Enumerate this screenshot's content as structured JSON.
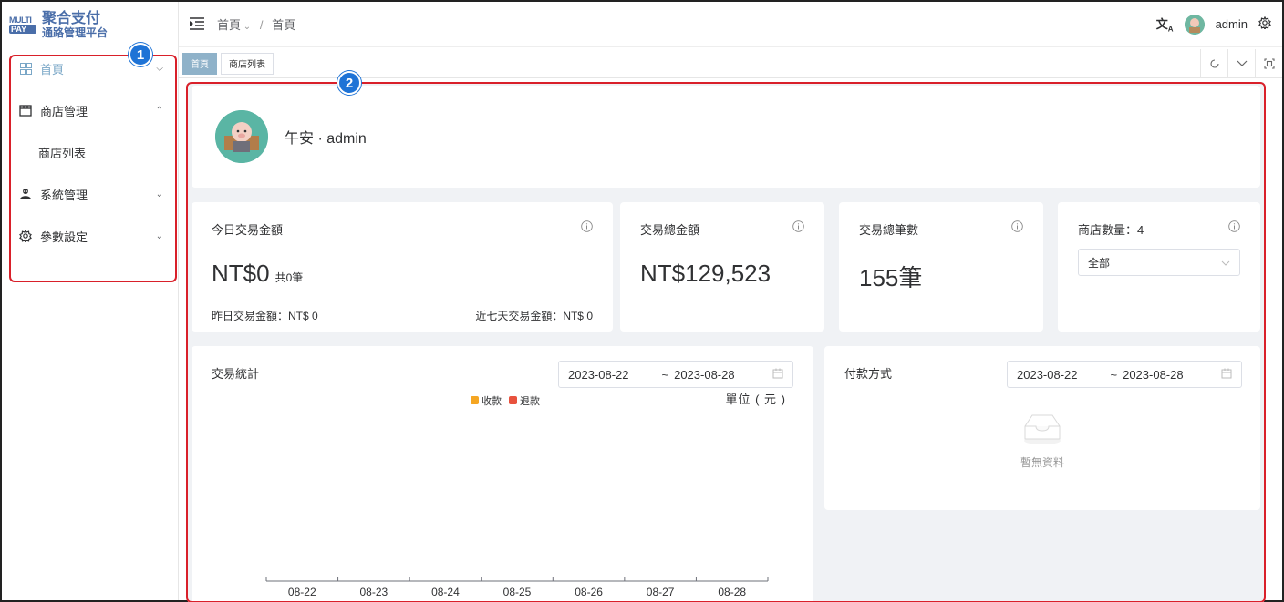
{
  "logo": {
    "badge_top": "MULTI",
    "badge_bottom": "PAY",
    "title": "聚合支付",
    "subtitle": "通路管理平台"
  },
  "sidebar": {
    "items": [
      {
        "label": "首頁",
        "icon": "dashboard-icon",
        "active": true
      },
      {
        "label": "商店管理",
        "icon": "store-icon",
        "expanded": true,
        "children": [
          {
            "label": "商店列表"
          }
        ]
      },
      {
        "label": "系統管理",
        "icon": "user-group-icon"
      },
      {
        "label": "參數設定",
        "icon": "gear-icon"
      }
    ]
  },
  "header": {
    "breadcrumb": [
      "首頁",
      "首頁"
    ],
    "username": "admin"
  },
  "tags": [
    "首頁",
    "商店列表"
  ],
  "callouts": [
    "1",
    "2"
  ],
  "welcome": {
    "greeting": "午安 · admin"
  },
  "stats": {
    "today": {
      "label": "今日交易金額",
      "value": "NT$0",
      "count": "共0筆",
      "yesterday": "昨日交易金額：NT$ 0",
      "week": "近七天交易金額：NT$ 0"
    },
    "total_amount": {
      "label": "交易總金額",
      "value": "NT$129,523"
    },
    "total_count": {
      "label": "交易總筆數",
      "value": "155筆"
    },
    "stores": {
      "label": "商店數量：4",
      "select_value": "全部"
    }
  },
  "chart_panel": {
    "title": "交易統計",
    "date_start": "2023-08-22",
    "date_sep": "~",
    "date_end": "2023-08-28",
    "legend": [
      {
        "name": "收款",
        "color": "#f5a623"
      },
      {
        "name": "退款",
        "color": "#e8523e"
      }
    ],
    "unit": "單位 ( 元 )"
  },
  "chart_data": {
    "type": "bar",
    "categories": [
      "08-22",
      "08-23",
      "08-24",
      "08-25",
      "08-26",
      "08-27",
      "08-28"
    ],
    "series": [
      {
        "name": "收款",
        "values": [
          0,
          0,
          0,
          0,
          0,
          0,
          0
        ]
      },
      {
        "name": "退款",
        "values": [
          0,
          0,
          0,
          0,
          0,
          0,
          0
        ]
      }
    ]
  },
  "pay_panel": {
    "title": "付款方式",
    "date_start": "2023-08-22",
    "date_sep": "~",
    "date_end": "2023-08-28",
    "empty_text": "暫無資料"
  }
}
